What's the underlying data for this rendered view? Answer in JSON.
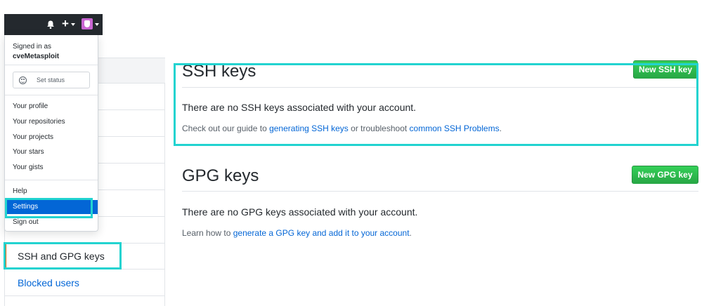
{
  "header": {
    "bell_icon": "bell-icon",
    "plus_icon": "plus-icon",
    "plus_label": "+",
    "avatar_icon": "avatar-icon"
  },
  "dropdown": {
    "signed_in_label": "Signed in as",
    "username": "cveMetasploit",
    "set_status_label": "Set status",
    "items": [
      {
        "label": "Your profile"
      },
      {
        "label": "Your repositories"
      },
      {
        "label": "Your projects"
      },
      {
        "label": "Your stars"
      },
      {
        "label": "Your gists"
      },
      {
        "label": "Help"
      },
      {
        "label": "Settings"
      },
      {
        "label": "Sign out"
      }
    ]
  },
  "sidebar": {
    "items": [
      {
        "label": "SSH and GPG keys"
      },
      {
        "label": "Blocked users"
      }
    ]
  },
  "ssh": {
    "title": "SSH keys",
    "button_label": "New SSH key",
    "empty_text": "There are no SSH keys associated with your account.",
    "help_prefix": "Check out our guide to ",
    "help_link1": "generating SSH keys",
    "help_middle": " or troubleshoot ",
    "help_link2": "common SSH Problems",
    "help_suffix": "."
  },
  "gpg": {
    "title": "GPG keys",
    "button_label": "New GPG key",
    "empty_text": "There are no GPG keys associated with your account.",
    "help_prefix": "Learn how to ",
    "help_link": "generate a GPG key and add it to your account",
    "help_suffix": "."
  },
  "colors": {
    "accent_blue": "#0366d6",
    "button_green": "#28a745",
    "highlight_cyan": "#22d3d0",
    "selected_border_orange": "#e36209",
    "header_dark": "#24292e"
  }
}
